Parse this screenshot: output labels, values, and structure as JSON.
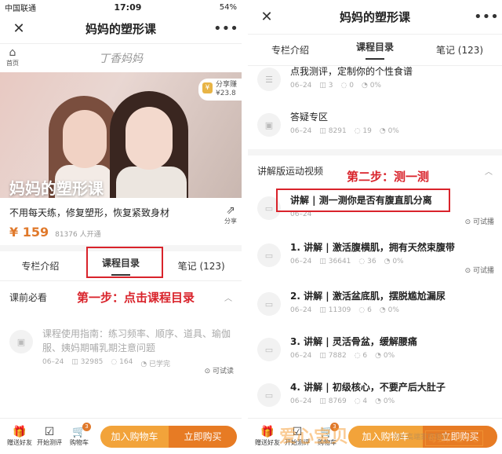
{
  "left": {
    "status": {
      "carrier": "中国联通",
      "time": "17:09",
      "battery": "54%"
    },
    "title": "妈妈的塑形课",
    "home_label": "首页",
    "brand": "丁香妈妈",
    "hero_title": "妈妈的塑形课",
    "share_badge": {
      "line1": "分享赚",
      "line2": "¥23.8"
    },
    "description": "不用每天练，修复塑形，恢复紧致身材",
    "share_label": "分享",
    "price": "¥ 159",
    "learners": "81376 人开通",
    "tabs": [
      "专栏介绍",
      "课程目录",
      "笔记 (123)"
    ],
    "section": "课前必看",
    "step_annotation": "第一步：点击课程目录",
    "item": {
      "title": "课程使用指南：练习频率、顺序、道具、瑜伽服、姨妈期哺乳期注意问题",
      "date": "06–24",
      "views": "32985",
      "comments": "164",
      "status": "已学完",
      "trial": "可试读"
    },
    "bottom": {
      "gift": "赠送好友",
      "test": "开始测评",
      "cart": "购物车",
      "cart_count": "3",
      "add_cart": "加入购物车",
      "buy": "立即购买"
    }
  },
  "right": {
    "title": "妈妈的塑形课",
    "tabs": [
      "专栏介绍",
      "课程目录",
      "笔记 (123)"
    ],
    "items_top": [
      {
        "title": "点我测评，定制你的个性食谱",
        "date": "06–24",
        "views": "3",
        "comments": "0",
        "progress": "0%"
      },
      {
        "title": "答疑专区",
        "date": "06–24",
        "views": "8291",
        "comments": "19",
        "progress": "0%"
      }
    ],
    "section": "讲解版运动视频",
    "step_annotation": "第二步：测一测",
    "items": [
      {
        "title": "讲解 | 测一测你是否有腹直肌分离",
        "date": "06–24",
        "views": "",
        "comments": "",
        "progress": "",
        "trial": "可试播"
      },
      {
        "title": "1. 讲解 | 激活腹横肌，拥有天然束腹带",
        "date": "06–24",
        "views": "36641",
        "comments": "36",
        "progress": "0%",
        "trial": "可试播"
      },
      {
        "title": "2. 讲解 | 激活盆底肌，摆脱尴尬漏尿",
        "date": "06–24",
        "views": "11309",
        "comments": "6",
        "progress": "0%",
        "trial": ""
      },
      {
        "title": "3. 讲解 | 灵活骨盆，缓解腰痛",
        "date": "06–24",
        "views": "7882",
        "comments": "6",
        "progress": "0%",
        "trial": ""
      },
      {
        "title": "4. 讲解 | 初级核心，不要产后大肚子",
        "date": "06–24",
        "views": "8769",
        "comments": "4",
        "progress": "0%",
        "trial": ""
      }
    ],
    "bottom": {
      "gift": "赠送好友",
      "test": "开始测评",
      "cart": "购物车",
      "cart_count": "3",
      "add_cart": "加入购物车",
      "buy": "立即购买"
    },
    "watermark": {
      "main": "爱心宝贝",
      "sub": "TM 高端家庭服务",
      "tag": "母婴护理中心"
    }
  }
}
